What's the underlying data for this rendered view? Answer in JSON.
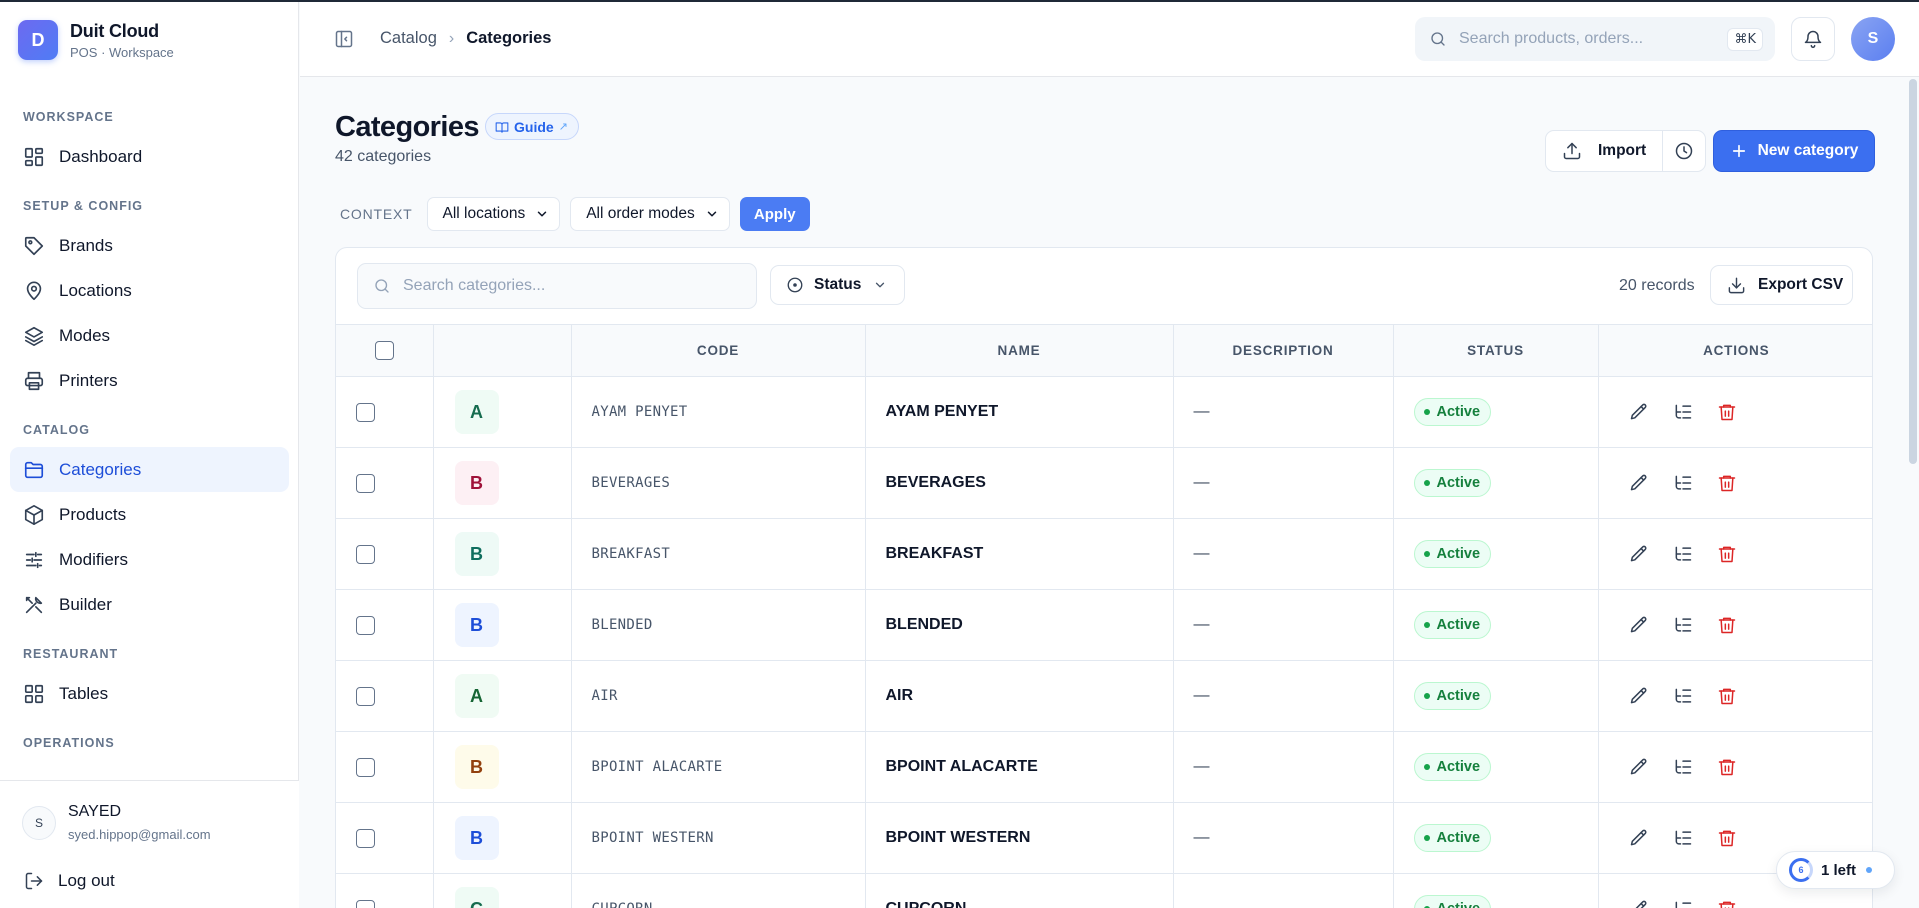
{
  "app": {
    "logo_letter": "D",
    "name": "Duit Cloud",
    "subtitle": "POS · Workspace"
  },
  "sidebar": {
    "sections": [
      {
        "title": "WORKSPACE",
        "items": [
          {
            "label": "Dashboard",
            "icon": "grid-icon"
          }
        ]
      },
      {
        "title": "SETUP & CONFIG",
        "items": [
          {
            "label": "Brands",
            "icon": "tag-icon"
          },
          {
            "label": "Locations",
            "icon": "map-pin-icon"
          },
          {
            "label": "Modes",
            "icon": "layers-icon"
          },
          {
            "label": "Printers",
            "icon": "printer-icon"
          }
        ]
      },
      {
        "title": "CATALOG",
        "items": [
          {
            "label": "Categories",
            "icon": "folder-icon",
            "active": true
          },
          {
            "label": "Products",
            "icon": "box-icon"
          },
          {
            "label": "Modifiers",
            "icon": "sliders-icon"
          },
          {
            "label": "Builder",
            "icon": "tools-icon"
          }
        ]
      },
      {
        "title": "RESTAURANT",
        "items": [
          {
            "label": "Tables",
            "icon": "grid-icon"
          }
        ]
      },
      {
        "title": "OPERATIONS",
        "items": []
      }
    ],
    "user": {
      "initial": "S",
      "name": "SAYED",
      "email": "syed.hippop@gmail.com"
    },
    "logout_label": "Log out"
  },
  "topbar": {
    "breadcrumb": {
      "parent": "Catalog",
      "current": "Categories"
    },
    "search_placeholder": "Search products, orders...",
    "shortcut": "⌘K",
    "avatar_initial": "S"
  },
  "page": {
    "title": "Categories",
    "guide_label": "Guide",
    "guide_arrow": "↗",
    "subtitle": "42 categories",
    "import_label": "Import",
    "new_label": "New category",
    "context_label": "CONTEXT",
    "location_select": "All locations",
    "mode_select": "All order modes",
    "apply_label": "Apply"
  },
  "table": {
    "search_placeholder": "Search categories...",
    "status_filter_label": "Status",
    "records_label": "20 records",
    "export_label": "Export CSV",
    "columns": [
      "CODE",
      "NAME",
      "DESCRIPTION",
      "STATUS",
      "ACTIONS"
    ],
    "rows": [
      {
        "letter": "A",
        "code": "AYAM PENYET",
        "name": "AYAM PENYET",
        "description": "—",
        "status": "Active",
        "tile_bg": "#effbf5",
        "tile_fg": "#166c4f"
      },
      {
        "letter": "B",
        "code": "BEVERAGES",
        "name": "BEVERAGES",
        "description": "—",
        "status": "Active",
        "tile_bg": "#fdf0f4",
        "tile_fg": "#9f1239"
      },
      {
        "letter": "B",
        "code": "BREAKFAST",
        "name": "BREAKFAST",
        "description": "—",
        "status": "Active",
        "tile_bg": "#eefaf6",
        "tile_fg": "#0f6e5e"
      },
      {
        "letter": "B",
        "code": "BLENDED",
        "name": "BLENDED",
        "description": "—",
        "status": "Active",
        "tile_bg": "#eef4ff",
        "tile_fg": "#1d4ed8"
      },
      {
        "letter": "A",
        "code": "AIR",
        "name": "AIR",
        "description": "—",
        "status": "Active",
        "tile_bg": "#f0fbf4",
        "tile_fg": "#166534"
      },
      {
        "letter": "B",
        "code": "BPOINT ALACARTE",
        "name": "BPOINT ALACARTE",
        "description": "—",
        "status": "Active",
        "tile_bg": "#fefbea",
        "tile_fg": "#92400e"
      },
      {
        "letter": "B",
        "code": "BPOINT WESTERN",
        "name": "BPOINT WESTERN",
        "description": "—",
        "status": "Active",
        "tile_bg": "#eef4ff",
        "tile_fg": "#1d4ed8"
      },
      {
        "letter": "C",
        "code": "CUPCORN",
        "name": "CUPCORN",
        "description": "—",
        "status": "Active",
        "tile_bg": "#effbf5",
        "tile_fg": "#166c4f"
      }
    ]
  },
  "floating": {
    "count": "6",
    "label": "1 left"
  },
  "colors": {
    "accent": "#3b6ff0",
    "active_bg": "#eef4fe",
    "active_text": "#1d4ed8",
    "delete": "#dc2626",
    "status_green": "#15803d"
  }
}
